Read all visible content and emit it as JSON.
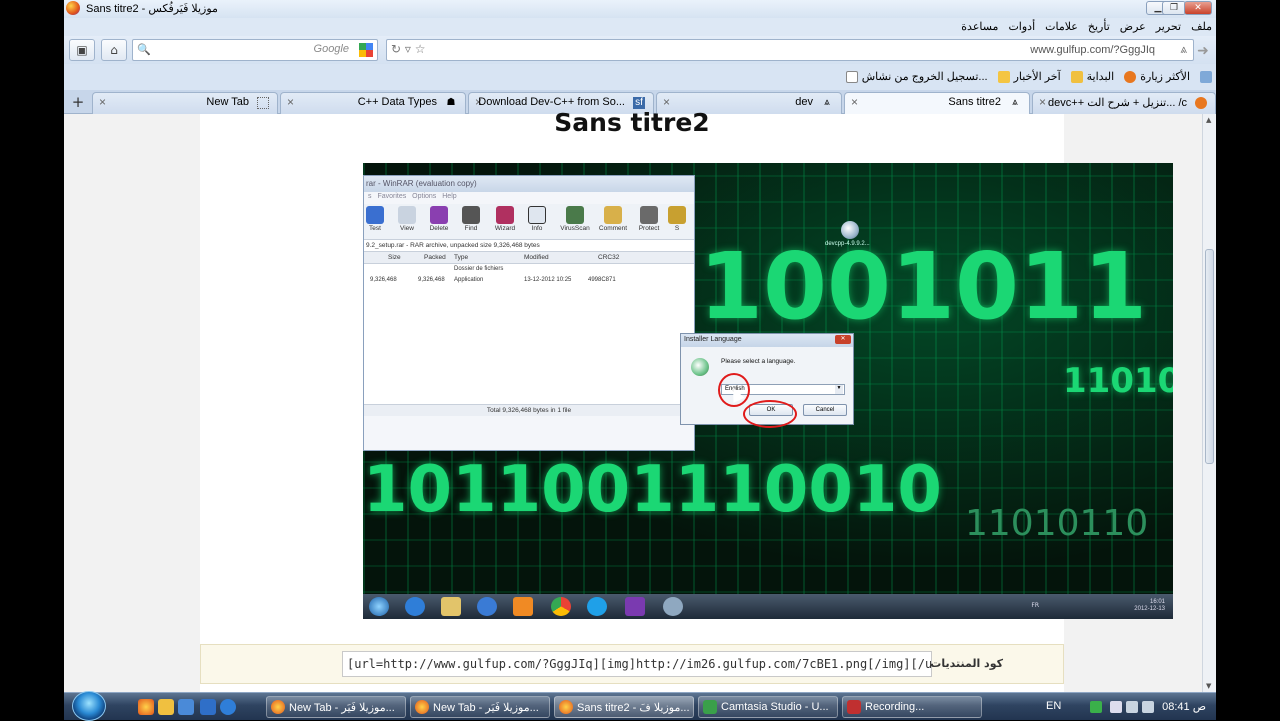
{
  "window": {
    "title": "Sans titre2 - موزيلا فَيَرفُكس",
    "buttons": {
      "minimize": "▁",
      "maximize": "❐",
      "close": "✕"
    }
  },
  "menubar": [
    "ملف",
    "تحرير",
    "عرض",
    "تأريخ",
    "علامات",
    "أدوات",
    "مساعدة"
  ],
  "navbar": {
    "search_placeholder": "Google",
    "url": "www.gulfup.com/?GggJIq"
  },
  "bookmarks": [
    "الأكثر زيارة",
    "البداية",
    "آخر الأخبار",
    "تسجيل الخروج من نشاش..."
  ],
  "tabs": [
    {
      "label": "devc++ تنزيل + شرح الت...  /c",
      "active": false
    },
    {
      "label": "Sans titre2",
      "active": true
    },
    {
      "label": "dev",
      "active": false
    },
    {
      "label": "Download Dev-C++ from So...",
      "active": false
    },
    {
      "label": "C++ Data Types",
      "active": false
    },
    {
      "label": "New Tab",
      "active": false
    }
  ],
  "page": {
    "title": "Sans titre2",
    "forum_code_label": "كود المنتديات",
    "forum_code_value": "[url=http://www.gulfup.com/?GggJIq][img]http://im26.gulfup.com/7cBE1.png[/img][/url]"
  },
  "screenshot": {
    "winrar_title": "rar - WinRAR (evaluation copy)",
    "winrar_menu": "s   Favorites   Options   Help",
    "tools": [
      "Test",
      "View",
      "Delete",
      "Find",
      "Wizard",
      "Info",
      "VirusScan",
      "Comment",
      "Protect",
      "S"
    ],
    "archive_path": "9.2_setup.rar - RAR archive, unpacked size 9,326,468 bytes",
    "columns": [
      "Size",
      "Packed",
      "Type",
      "Modified",
      "CRC32"
    ],
    "rows": [
      {
        "size": "",
        "packed": "",
        "type": "Dossier de fichiers",
        "modified": "",
        "crc": ""
      },
      {
        "size": "9,326,468",
        "packed": "9,326,468",
        "type": "Application",
        "modified": "13-12-2012 10:25",
        "crc": "4998C871"
      }
    ],
    "status": "Total 9,326,468 bytes in 1 file",
    "dialog_title": "Installer Language",
    "dialog_message": "Please select a language.",
    "dialog_select": "English",
    "ok": "OK",
    "cancel": "Cancel",
    "desktop_icon_label": "devcpp-4.9.9.2...",
    "binary_top": "1001011",
    "binary_right": "11010",
    "binary_bottom": "1011001110010",
    "binary_bottom_right": "11010110",
    "inner_tray_lang": "FR",
    "inner_clock_time": "16:01",
    "inner_clock_date": "2012-12-13"
  },
  "taskbar": {
    "tasks": [
      {
        "label": "New Tab - موزيلا فَيَر...",
        "active": false
      },
      {
        "label": "New Tab - موزيلا فَيَر...",
        "active": false
      },
      {
        "label": "Sans titre2 - موزيلا فَ...",
        "active": true
      },
      {
        "label": "Camtasia Studio - U...",
        "active": false
      },
      {
        "label": "Recording...",
        "active": false
      }
    ],
    "lang": "EN",
    "clock": "08:41 ص"
  },
  "colors": {
    "accent": "#1bd774",
    "taskbar": "#2f4461",
    "chrome": "#dfe9f5"
  }
}
